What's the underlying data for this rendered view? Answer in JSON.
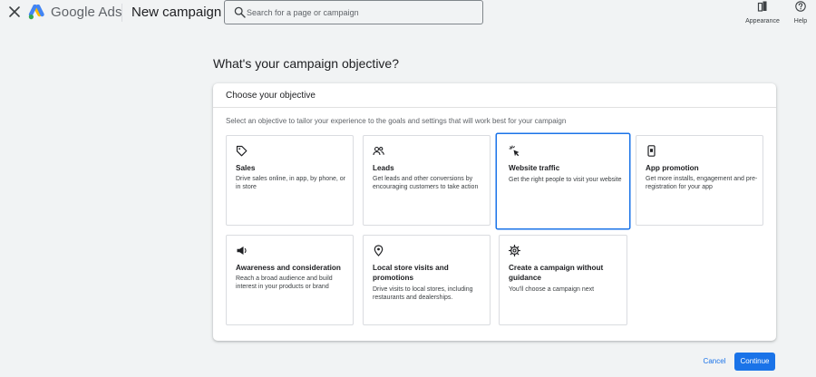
{
  "header": {
    "brand": "Google Ads",
    "page_title": "New campaign",
    "search_placeholder": "Search for a page or campaign",
    "appearance_label": "Appearance",
    "help_label": "Help"
  },
  "main": {
    "heading": "What's your campaign objective?",
    "panel_title": "Choose your objective",
    "panel_description": "Select an objective to tailor your experience to the goals and settings that will work best for your campaign",
    "objectives": [
      {
        "title": "Sales",
        "description": "Drive sales online, in app, by phone, or in store",
        "icon": "tag-icon",
        "selected": false
      },
      {
        "title": "Leads",
        "description": "Get leads and other conversions by encouraging customers to take action",
        "icon": "people-icon",
        "selected": false
      },
      {
        "title": "Website traffic",
        "description": "Get the right people to visit your website",
        "icon": "cursor-click-icon",
        "selected": true
      },
      {
        "title": "App promotion",
        "description": "Get more installs, engagement and pre-registration for your app",
        "icon": "phone-icon",
        "selected": false
      },
      {
        "title": "Awareness and consideration",
        "description": "Reach a broad audience and build interest in your products or brand",
        "icon": "megaphone-icon",
        "selected": false
      },
      {
        "title": "Local store visits and promotions",
        "description": "Drive visits to local stores, including restaurants and dealerships.",
        "icon": "location-pin-icon",
        "selected": false
      },
      {
        "title": "Create a campaign without guidance",
        "description": "You'll choose a campaign next",
        "icon": "gear-icon",
        "selected": false
      }
    ]
  },
  "footer": {
    "cancel_label": "Cancel",
    "continue_label": "Continue"
  },
  "colors": {
    "accent": "#1a73e8",
    "background": "#f1f3f4"
  }
}
